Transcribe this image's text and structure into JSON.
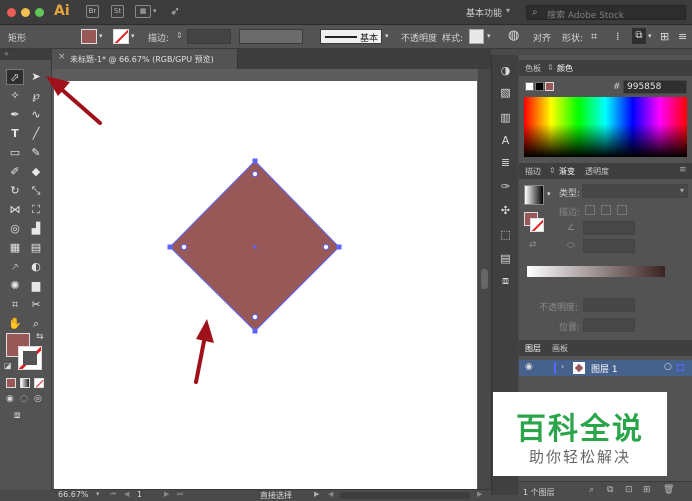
{
  "app": {
    "logo": "Ai",
    "workspace": "基本功能",
    "search_placeholder": "搜索 Adobe Stock"
  },
  "control_bar": {
    "selection_label": "矩形",
    "stroke_label": "描边:",
    "stroke_style": "基本",
    "opacity_label": "不透明度",
    "style_label": "样式:",
    "align_label": "对齐",
    "shape_label": "形状:"
  },
  "document": {
    "tab_title": "未标题-1* @ 66.67% (RGB/GPU 预览)"
  },
  "status_bar": {
    "zoom": "66.67%",
    "artboard_number": "1",
    "tool_name": "直接选择"
  },
  "color_panel": {
    "tabs": [
      "色板",
      "颜色"
    ],
    "hex_prefix": "#",
    "hex_value": "995858"
  },
  "gradient_panel": {
    "tabs": [
      "描边",
      "渐变",
      "透明度"
    ],
    "type_label": "类型:",
    "stroke_label": "描边:",
    "opacity_label": "不透明度:",
    "position_label": "位置:"
  },
  "layers_panel": {
    "tabs": [
      "图层",
      "画板"
    ],
    "layer_name": "图层 1",
    "footer_count": "1 个图层"
  },
  "watermark": {
    "title": "百科全说",
    "subtitle": "助你轻松解决"
  },
  "colors": {
    "fill": "#995858",
    "selection": "#5a66ff",
    "arrow": "#a0101a"
  }
}
